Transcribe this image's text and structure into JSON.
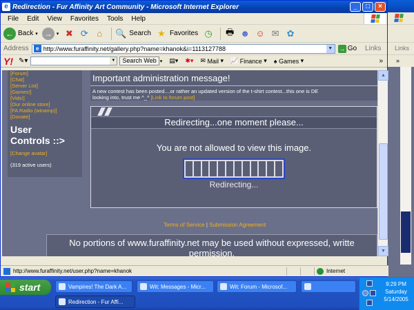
{
  "window": {
    "title": "Redirection - Fur Affinity Art Community - Microsoft Internet Explorer",
    "min_glyph": "_",
    "max_glyph": "□",
    "close_glyph": "×"
  },
  "menu": [
    "File",
    "Edit",
    "View",
    "Favorites",
    "Tools",
    "Help"
  ],
  "toolbar": {
    "back_label": "Back",
    "search_label": "Search",
    "favorites_label": "Favorites"
  },
  "address": {
    "label": "Address",
    "url": "http://www.furaffinity.net/gallery.php?name=khanok&i=1113127788",
    "go_label": "Go",
    "links_label": "Links"
  },
  "yahoo": {
    "logo": "Y!",
    "search_button": "Search Web",
    "mail": "Mail",
    "finance": "Finance",
    "games": "Games"
  },
  "sidebar": {
    "links": [
      "[Forum]",
      "[Chat]",
      "[Server List]",
      "[Games!]",
      "[Vids!]",
      "[Our online store]",
      "[FA Radio (winamp)]",
      "[Donate]"
    ],
    "user_controls_line1": "User",
    "user_controls_line2": "Controls ::>",
    "change_avatar": "[Change avatar]",
    "active_users": "(319 active users)"
  },
  "admin": {
    "title": "Important administration message!",
    "text_line1": "A new contest has been posted....or rather an updated version of the t-shirt contest...this one is DE",
    "text_line2": "looking into, trust me ^_^ ",
    "link": "[Link to forum post]"
  },
  "redirect": {
    "heading": "Redirecting...one moment please...",
    "message": "You are not allowed to view this image.",
    "status": "Redirecting...",
    "progress_cells": 12
  },
  "footer": {
    "terms": "Terms of Service",
    "separator": "|",
    "agreement": "Submission Agreement"
  },
  "disclaimer": {
    "line1": "No portions of www.furaffinity.net may be used without expressed, writte",
    "line2": "permission."
  },
  "background_window": {
    "links_label": "Links",
    "chevron": "»"
  },
  "status_bar": {
    "text": "http://www.furaffinity.net/user.php?name=khanok",
    "zone": "Internet"
  },
  "taskbar": {
    "start_label": "start",
    "tasks": [
      "Vampires! The Dark A...",
      "Wit: Messages - Micr...",
      "Wit: Forum - Microsof...",
      "",
      "Redirection - Fur Affi..."
    ],
    "clock_time": "9:29 PM",
    "clock_day": "Saturday",
    "clock_date": "5/14/2005"
  },
  "colors": {
    "page_bg": "#6a6f8a",
    "panel_bg": "#5a5f76",
    "link_orange": "#f2b21a",
    "progress_border": "#2946c4"
  },
  "icons": {
    "back": "back-arrow-icon",
    "forward": "forward-arrow-icon",
    "stop": "stop-icon",
    "refresh": "refresh-icon",
    "home": "home-icon",
    "search": "search-icon",
    "favorites": "favorites-star-icon",
    "history": "history-icon"
  }
}
